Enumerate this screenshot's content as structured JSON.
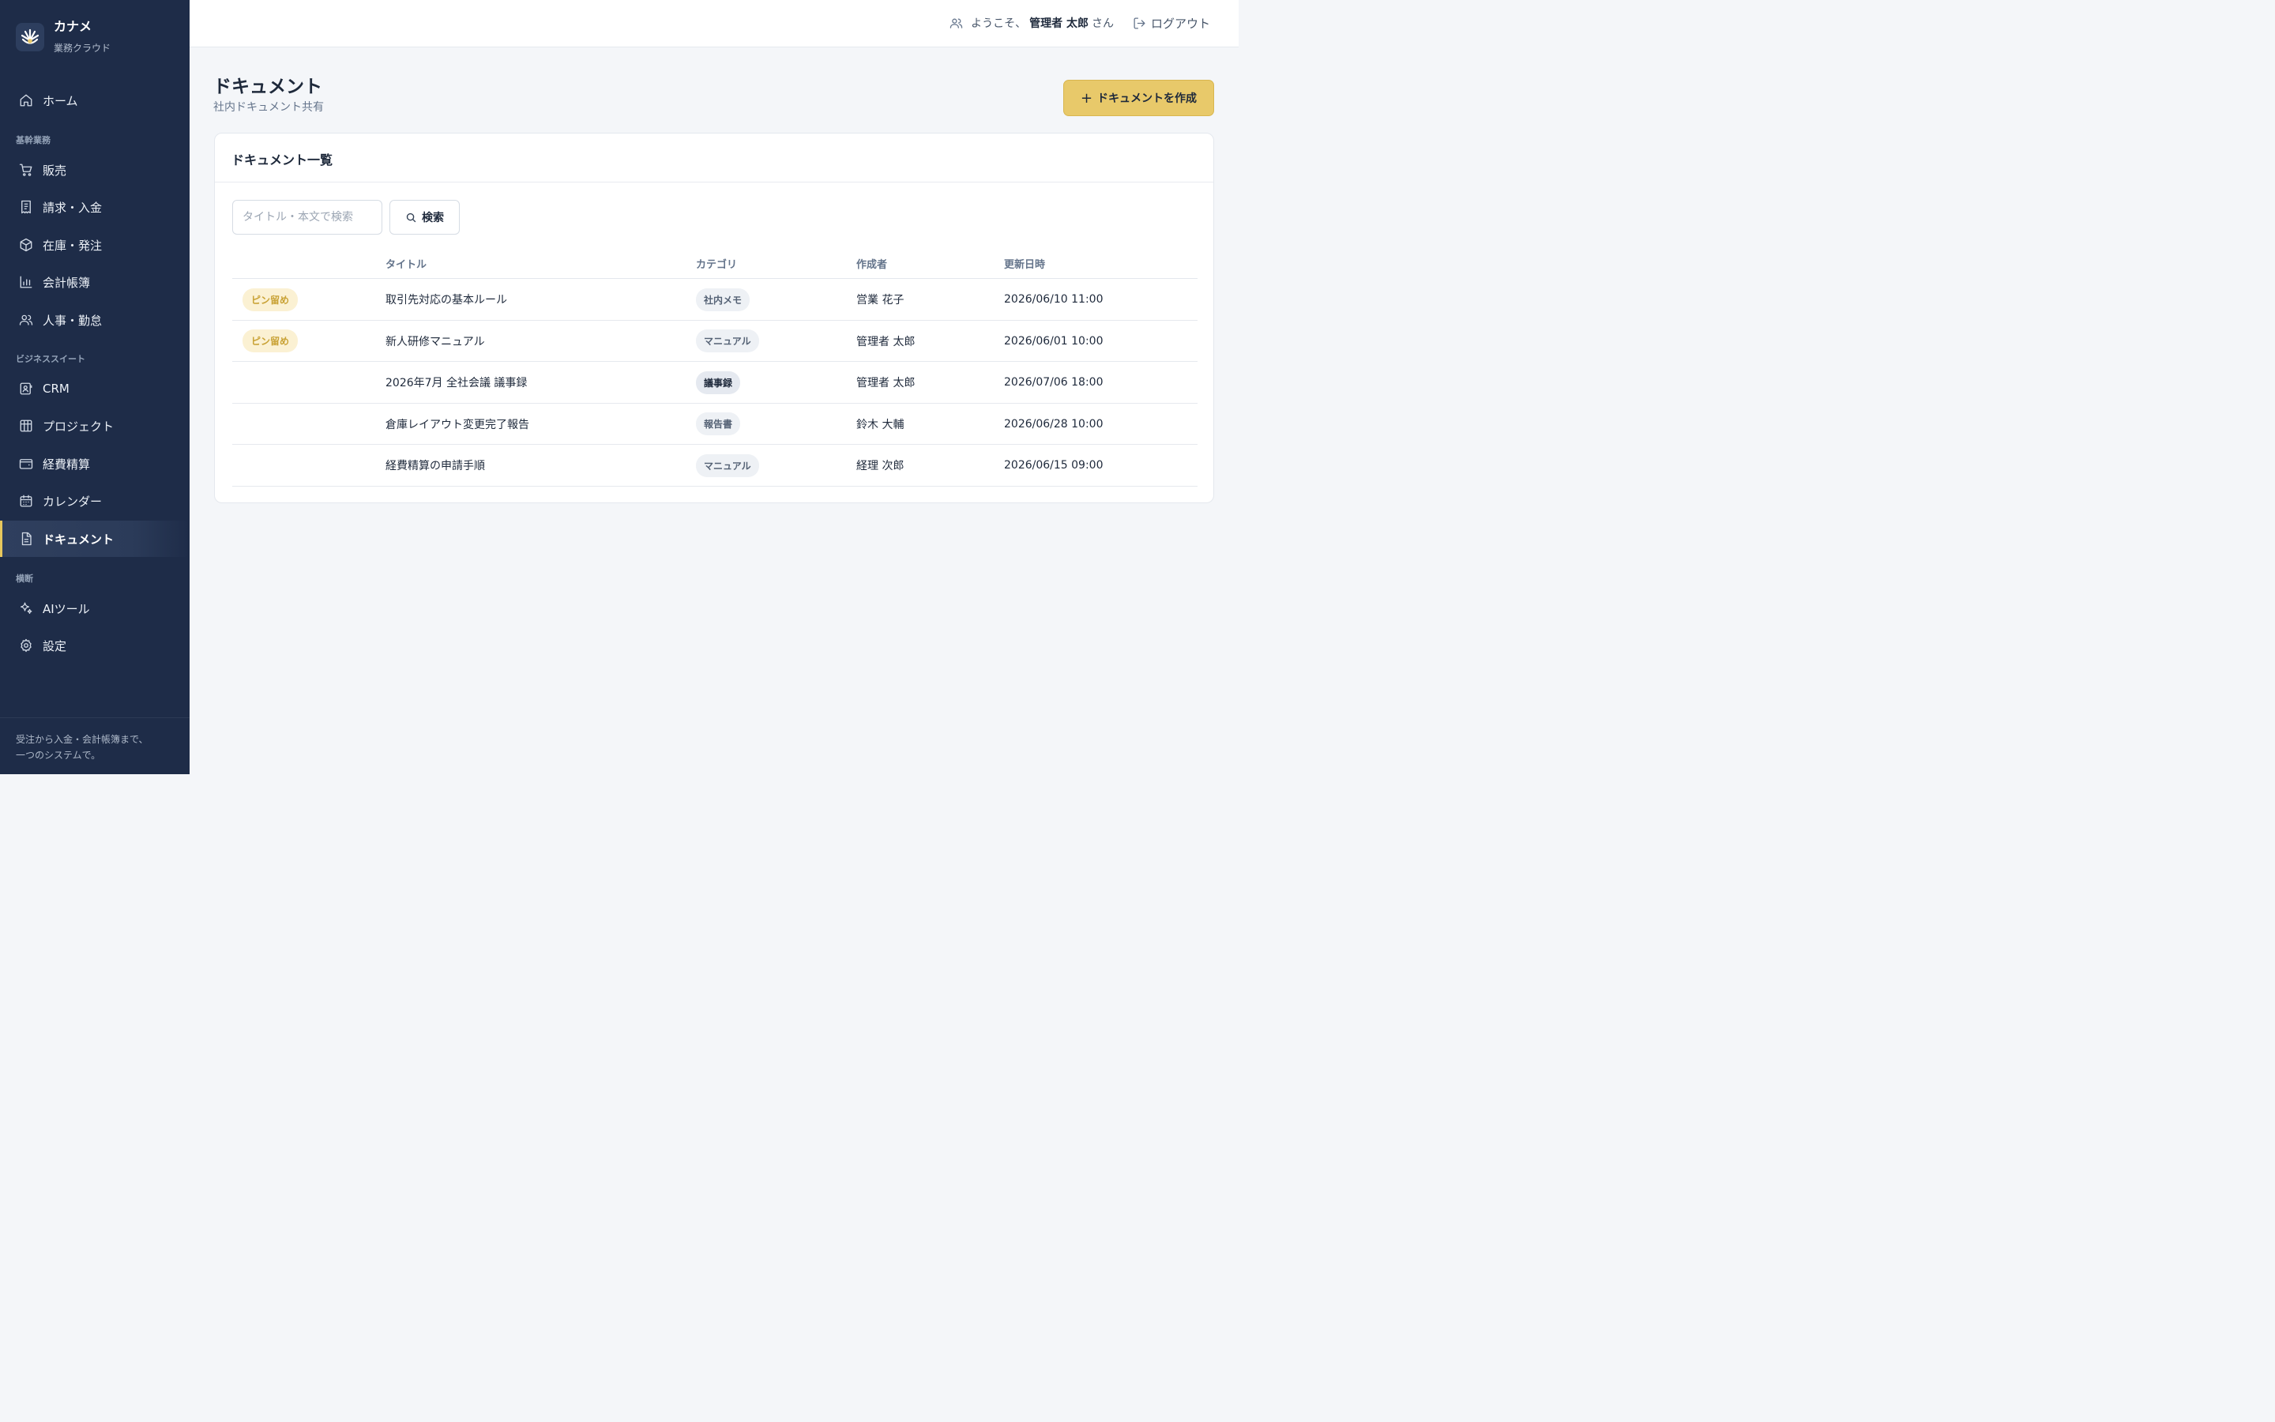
{
  "brand": {
    "name": "カナメ",
    "sub": "業務クラウド"
  },
  "sidebar": {
    "home": "ホーム",
    "section_core": "基幹業務",
    "sales": "販売",
    "billing": "請求・入金",
    "inventory": "在庫・発注",
    "accounting": "会計帳簿",
    "hr": "人事・勤怠",
    "section_suite": "ビジネススイート",
    "crm": "CRM",
    "project": "プロジェクト",
    "expense": "経費精算",
    "calendar": "カレンダー",
    "documents": "ドキュメント",
    "section_cross": "横断",
    "ai": "AIツール",
    "settings": "設定",
    "footer_line1": "受注から入金・会計帳簿まで、",
    "footer_line2": "一つのシステムで。"
  },
  "topbar": {
    "welcome_prefix": "ようこそ、",
    "user_name": "管理者 太郎",
    "welcome_suffix": "さん",
    "logout": "ログアウト"
  },
  "page": {
    "title": "ドキュメント",
    "subtitle": "社内ドキュメント共有",
    "create_plus": "+",
    "create_label": "ドキュメントを作成"
  },
  "card": {
    "title": "ドキュメント一覧",
    "search_placeholder": "タイトル・本文で検索",
    "search_value": "",
    "search_button": "検索"
  },
  "table": {
    "headers": {
      "title": "タイトル",
      "category": "カテゴリ",
      "author": "作成者",
      "updated": "更新日時"
    },
    "rows": [
      {
        "pin": "ピン留め",
        "title": "取引先対応の基本ルール",
        "category": "社内メモ",
        "author": "営業 花子",
        "updated": "2026/06/10 11:00"
      },
      {
        "pin": "ピン留め",
        "title": "新人研修マニュアル",
        "category": "マニュアル",
        "author": "管理者 太郎",
        "updated": "2026/06/01 10:00"
      },
      {
        "pin": "",
        "title": "2026年7月 全社会議 議事録",
        "category": "議事録",
        "author": "管理者 太郎",
        "updated": "2026/07/06 18:00"
      },
      {
        "pin": "",
        "title": "倉庫レイアウト変更完了報告",
        "category": "報告書",
        "author": "鈴木 大輔",
        "updated": "2026/06/28 10:00"
      },
      {
        "pin": "",
        "title": "経費精算の申請手順",
        "category": "マニュアル",
        "author": "経理 次郎",
        "updated": "2026/06/15 09:00"
      }
    ]
  },
  "colors": {
    "sidebar_bg": "#1e2c48",
    "accent": "#e8c96a",
    "pin_badge_bg": "#fbf1d3",
    "pin_badge_text": "#c9a235"
  }
}
